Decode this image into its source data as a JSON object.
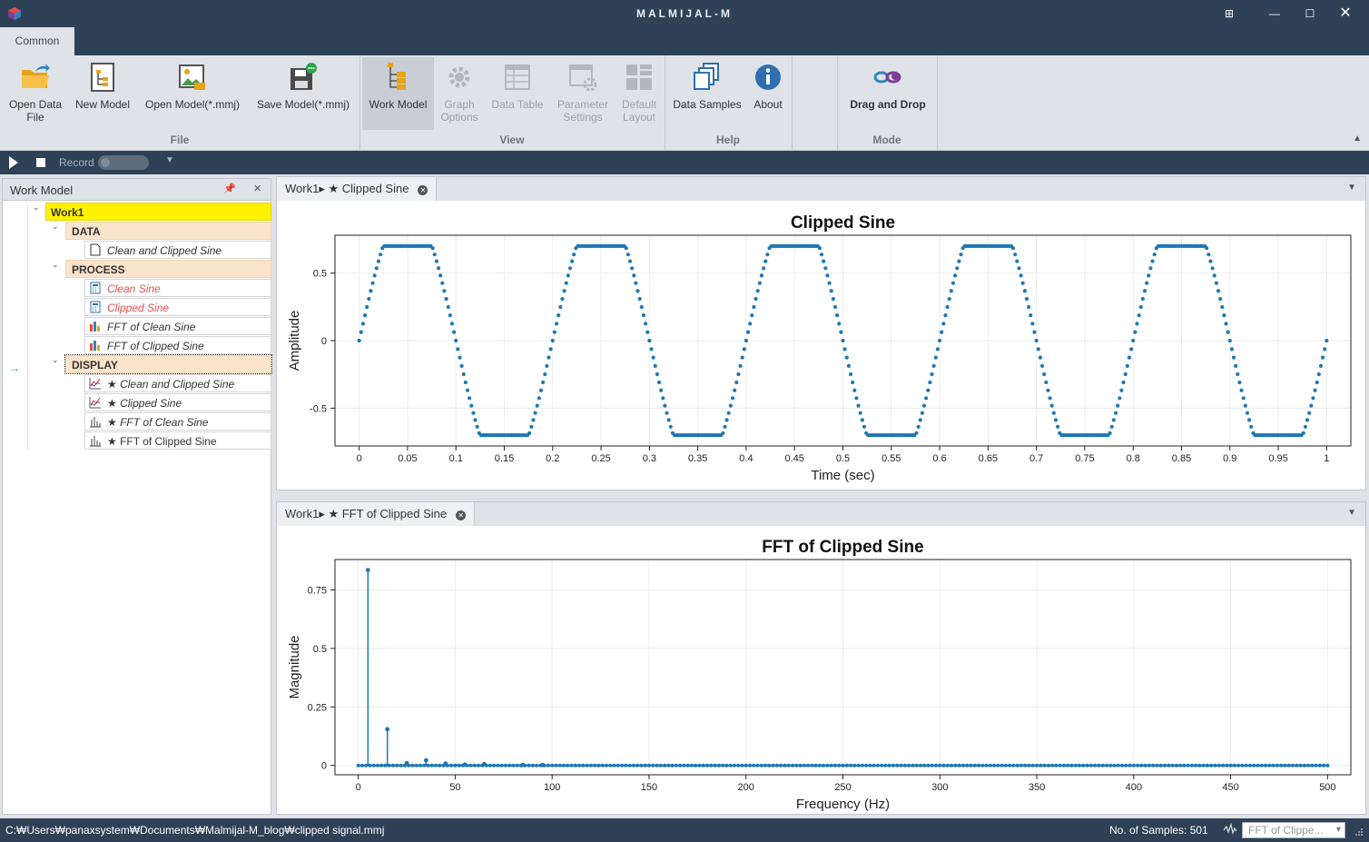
{
  "window": {
    "title": "MALMIJAL-M",
    "logo_icon": "cube-logo-icon"
  },
  "ribbon": {
    "tab": "Common",
    "file_group": "File",
    "view_group": "View",
    "help_group": "Help",
    "mode_group": "Mode",
    "open_data_file_l1": "Open Data",
    "open_data_file_l2": "File",
    "new_model": "New Model",
    "open_model": "Open Model(*.mmj)",
    "save_model": "Save Model(*.mmj)",
    "work_model": "Work Model",
    "graph_options_l1": "Graph",
    "graph_options_l2": "Options",
    "data_table": "Data Table",
    "parameter_settings_l1": "Parameter",
    "parameter_settings_l2": "Settings",
    "default_layout_l1": "Default",
    "default_layout_l2": "Layout",
    "data_samples": "Data Samples",
    "about": "About",
    "drag_and_drop": "Drag and Drop"
  },
  "toolbar": {
    "record_label": "Record"
  },
  "work_model": {
    "title": "Work Model",
    "root": "Work1",
    "data_label": "DATA",
    "data_items": [
      "Clean and Clipped Sine"
    ],
    "process_label": "PROCESS",
    "process_items": [
      "Clean Sine",
      "Clipped Sine",
      "FFT of Clean Sine",
      "FFT of Clipped Sine"
    ],
    "display_label": "DISPLAY",
    "display_items": [
      "★ Clean and Clipped Sine",
      "★ Clipped Sine",
      "★ FFT of Clean Sine",
      "★ FFT of Clipped Sine"
    ]
  },
  "doc1": {
    "tab": "Work1▸ ★ Clipped Sine"
  },
  "doc2": {
    "tab": "Work1▸ ★ FFT of Clipped Sine"
  },
  "chart_data": [
    {
      "type": "scatter",
      "title": "Clipped Sine",
      "xlabel": "Time (sec)",
      "ylabel": "Amplitude",
      "xlim": [
        -0.025,
        1.025
      ],
      "ylim": [
        -0.78,
        0.78
      ],
      "xticks": [
        "0",
        "0.05",
        "0.1",
        "0.15",
        "0.2",
        "0.25",
        "0.3",
        "0.35",
        "0.4",
        "0.45",
        "0.5",
        "0.55",
        "0.6",
        "0.65",
        "0.7",
        "0.75",
        "0.8",
        "0.85",
        "0.9",
        "0.95",
        "1"
      ],
      "yticks": [
        "-0.5",
        "0",
        "0.5"
      ],
      "signal": {
        "frequency_hz": 5,
        "amplitude": 1,
        "clip_level": 0.7,
        "samples": 501,
        "t_start": 0,
        "t_end": 1
      },
      "color": "#1f77b4",
      "grid": true
    },
    {
      "type": "stem",
      "title": "FFT of Clipped Sine",
      "xlabel": "Frequency (Hz)",
      "ylabel": "Magnitude",
      "xlim": [
        -12,
        512
      ],
      "ylim": [
        -0.04,
        0.88
      ],
      "xticks": [
        "0",
        "50",
        "100",
        "150",
        "200",
        "250",
        "300",
        "350",
        "400",
        "450",
        "500"
      ],
      "yticks": [
        "0",
        "0.25",
        "0.5",
        "0.75"
      ],
      "peaks": [
        [
          5,
          0.835
        ],
        [
          15,
          0.155
        ],
        [
          25,
          0.01
        ],
        [
          35,
          0.022
        ],
        [
          45,
          0.008
        ],
        [
          55,
          0.004
        ],
        [
          65,
          0.006
        ],
        [
          85,
          0.002
        ],
        [
          95,
          0.002
        ]
      ],
      "x_range": [
        0,
        500
      ],
      "color": "#1f77b4",
      "grid": true
    }
  ],
  "status": {
    "path": "C:₩Users₩panaxsystem₩Documents₩Malmijal-M_blog₩clipped signal.mmj",
    "samples": "No. of Samples: 501",
    "combo": "FFT of Clippe..."
  }
}
